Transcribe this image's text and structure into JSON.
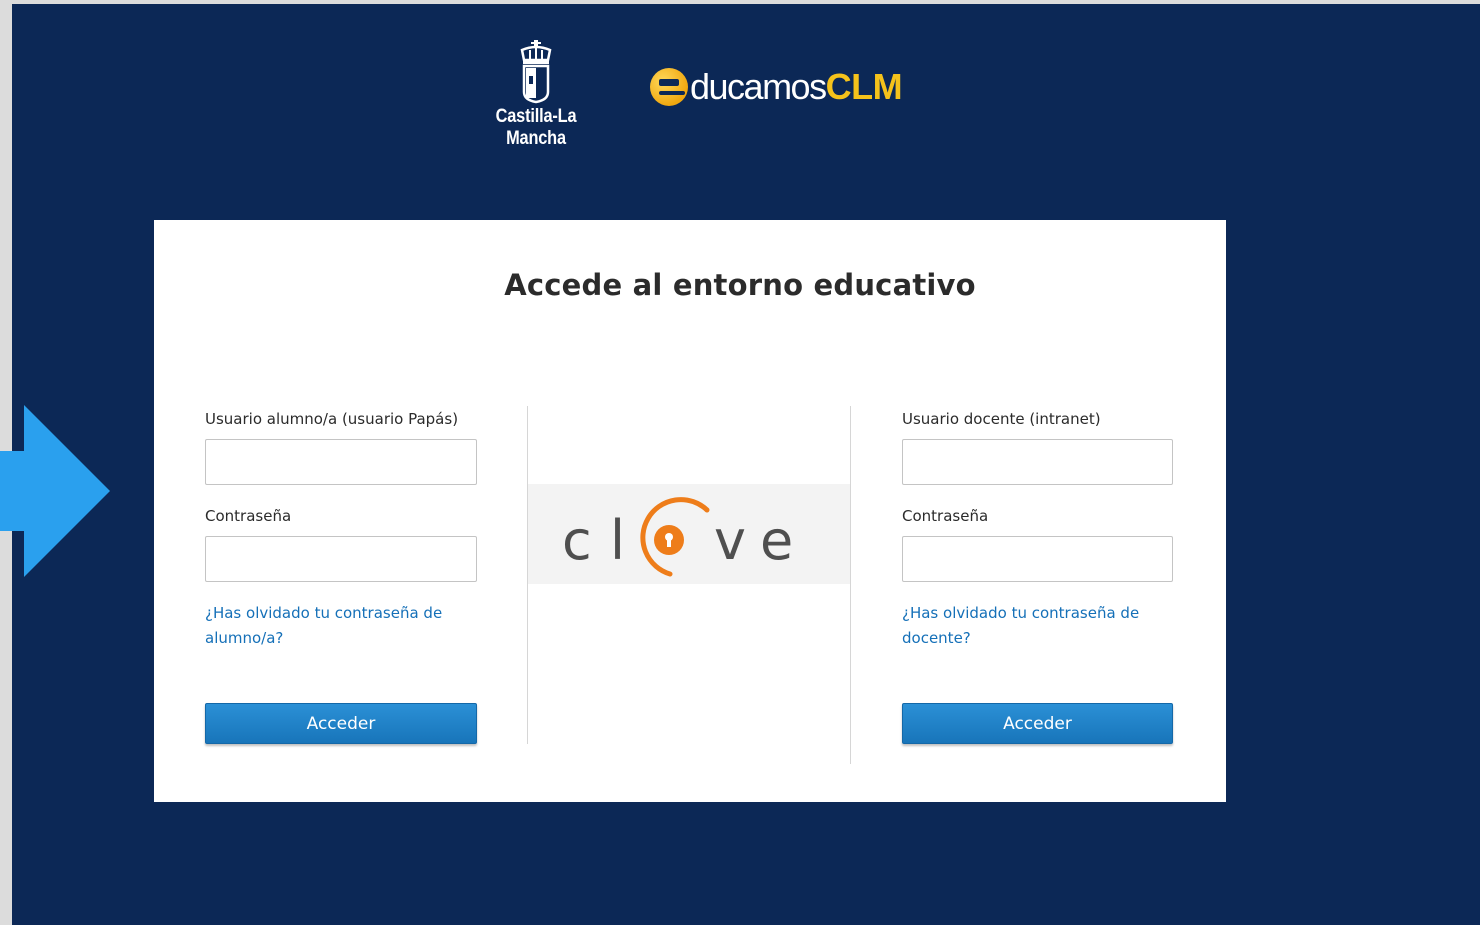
{
  "colors": {
    "page_background": "#0c2856",
    "accent_orange": "#ee7d1a",
    "button_blue": "#1f82c8",
    "link_blue": "#1570b8",
    "arrow_blue": "#2aa0ee",
    "logo_yellow": "#f5c21b"
  },
  "header": {
    "region_logo_text": "Castilla-La Mancha",
    "brand_logo": {
      "part1": "ducamos",
      "part2": "CLM",
      "icon": "educamos-e-icon"
    }
  },
  "annotation": {
    "icon": "arrow-right-icon"
  },
  "login": {
    "title": "Accede al entorno educativo",
    "student": {
      "user_label": "Usuario alumno/a (usuario Papás)",
      "user_value": "",
      "password_label": "Contraseña",
      "password_value": "",
      "forgot_line1": "¿Has olvidado tu contraseña de",
      "forgot_line2": "alumno/a?",
      "submit_label": "Acceder"
    },
    "clave": {
      "c1": "c",
      "c2": "l",
      "c3": "v",
      "c4": "e",
      "icon": "clave-at-lock-icon"
    },
    "teacher": {
      "user_label": "Usuario docente (intranet)",
      "user_value": "",
      "password_label": "Contraseña",
      "password_value": "",
      "forgot_line1": "¿Has olvidado tu contraseña de",
      "forgot_line2": "docente?",
      "submit_label": "Acceder"
    }
  }
}
